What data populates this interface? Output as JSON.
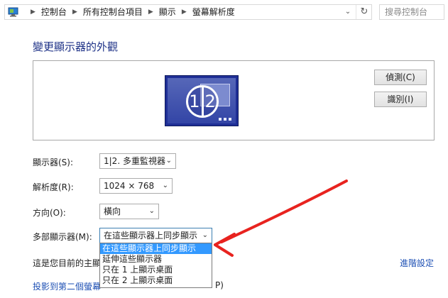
{
  "address_bar": {
    "breadcrumbs": [
      "控制台",
      "所有控制台項目",
      "顯示",
      "螢幕解析度"
    ],
    "search_placeholder": "搜尋控制台"
  },
  "title": "變更顯示器的外觀",
  "preview": {
    "monitor_label_left": "1",
    "monitor_label_right": "2",
    "detect_button": "偵測(C)",
    "identify_button": "識別(I)"
  },
  "settings": {
    "display_label": "顯示器(S):",
    "display_value": "1|2. 多重監視器",
    "resolution_label": "解析度(R):",
    "resolution_value": "1024 × 768",
    "orientation_label": "方向(O):",
    "orientation_value": "橫向",
    "multi_label": "多部顯示器(M):",
    "multi_value": "在這些顯示器上同步顯示",
    "multi_options": [
      "在這些顯示器上同步顯示",
      "延伸這些顯示器",
      "只在 1 上顯示桌面",
      "只在 2 上顯示桌面"
    ]
  },
  "main_display_text": "這是您目前的主顯",
  "advanced_link": "進階設定",
  "project_link": "投影到第二個螢幕",
  "project_suffix": "P)",
  "annotation_color": "#e8231f"
}
